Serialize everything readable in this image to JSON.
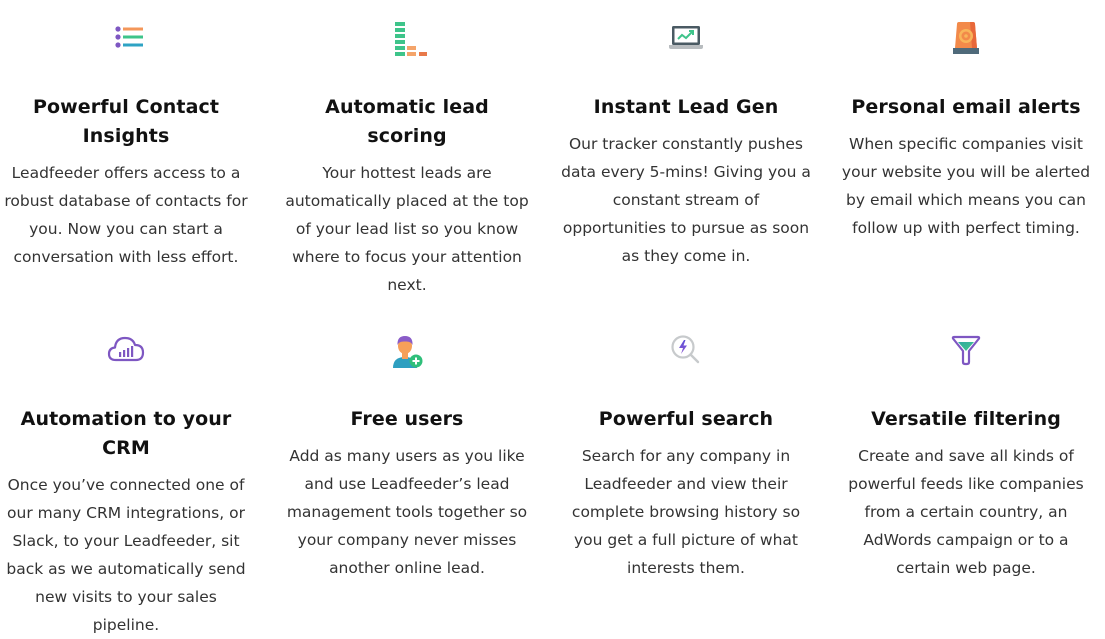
{
  "features": [
    {
      "icon": "list-icon",
      "title": "Powerful Contact Insights",
      "title_lines": [
        "Powerful Contact",
        "Insights"
      ],
      "description": "Leadfeeder offers access to a robust database of contacts for you. Now you can start a conversation with less effort."
    },
    {
      "icon": "bar-scoring-icon",
      "title": "Automatic lead scoring",
      "title_lines": [
        "Automatic lead",
        "scoring"
      ],
      "description": "Your hottest leads are automatically placed at the top of your lead list so you know where to focus your attention next."
    },
    {
      "icon": "laptop-trend-icon",
      "title": "Instant Lead Gen",
      "title_lines": [
        "Instant Lead Gen"
      ],
      "description": "Our tracker constantly pushes data every 5-mins! Giving you a constant stream of opportunities to pursue as soon as they come in."
    },
    {
      "icon": "siren-alert-icon",
      "title": "Personal email alerts",
      "title_lines": [
        "Personal email alerts"
      ],
      "description": "When specific companies visit your website you will be alerted by email which means you can follow up with perfect timing."
    },
    {
      "icon": "cloud-chart-icon",
      "title": "Automation to your CRM",
      "title_lines": [
        "Automation to your",
        "CRM"
      ],
      "description": "Once you’ve connected one of our many CRM integrations, or Slack, to your Leadfeeder, sit back as we automatically send new visits to your sales pipeline."
    },
    {
      "icon": "add-user-icon",
      "title": "Free users",
      "title_lines": [
        "Free users"
      ],
      "description": "Add as many users as you like and use Leadfeeder’s lead management tools together so your company never misses another online lead."
    },
    {
      "icon": "search-bolt-icon",
      "title": "Powerful search",
      "title_lines": [
        "Powerful search"
      ],
      "description": "Search for any company in Leadfeeder and view their complete browsing history so you get a full picture of what interests them."
    },
    {
      "icon": "funnel-filter-icon",
      "title": "Versatile filtering",
      "title_lines": [
        "Versatile filtering"
      ],
      "description": "Create and save all kinds of powerful feeds like companies from a certain country, an AdWords campaign or to a certain web page."
    }
  ],
  "colors": {
    "purple": "#7e57c2",
    "orange": "#f4975a",
    "green": "#3ec48a",
    "teal": "#2ea3c4",
    "dark_orange": "#e8794a",
    "laptop_frame": "#4a5a63",
    "laptop_base": "#b8bcbf",
    "siren_body": "#f28a4a",
    "siren_base": "#4f6a7a",
    "siren_light": "#f8b55a",
    "user_hair": "#8a5cc8",
    "user_skin": "#f6a05a",
    "user_shirt": "#2e9fc0",
    "plus_green": "#2fbf7a",
    "search_ring": "#c7cacc",
    "funnel_outline": "#7e57c2",
    "funnel_fill": "#3cc08a",
    "title_text": "#111111",
    "body_text": "#333333"
  }
}
